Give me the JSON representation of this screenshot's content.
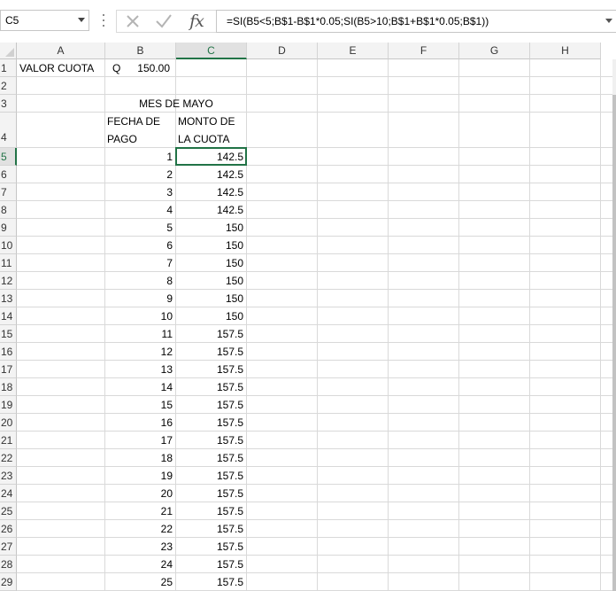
{
  "namebox": {
    "value": "C5"
  },
  "formula": {
    "text": "=SI(B5<5;B$1-B$1*0.05;SI(B5>10;B$1+B$1*0.05;B$1))",
    "fx_label": "fx"
  },
  "columns": [
    "A",
    "B",
    "C",
    "D",
    "E",
    "F",
    "G",
    "H"
  ],
  "rows": [
    "1",
    "2",
    "3",
    "4",
    "5",
    "6",
    "7",
    "8",
    "9",
    "10",
    "11",
    "12",
    "13",
    "14",
    "15",
    "16",
    "17",
    "18",
    "19",
    "20",
    "21",
    "22",
    "23",
    "24",
    "25",
    "26",
    "27",
    "28",
    "29"
  ],
  "cells": {
    "a1": "VALOR CUOTA",
    "b1_prefix": "Q",
    "b1_value": "150.00",
    "title": "MES DE MAYO",
    "header_b_line1": "FECHA DE",
    "header_b_line2": "PAGO",
    "header_c_line1": "MONTO DE",
    "header_c_line2": "LA CUOTA"
  },
  "table": [
    {
      "day": "1",
      "amount": "142.5"
    },
    {
      "day": "2",
      "amount": "142.5"
    },
    {
      "day": "3",
      "amount": "142.5"
    },
    {
      "day": "4",
      "amount": "142.5"
    },
    {
      "day": "5",
      "amount": "150"
    },
    {
      "day": "6",
      "amount": "150"
    },
    {
      "day": "7",
      "amount": "150"
    },
    {
      "day": "8",
      "amount": "150"
    },
    {
      "day": "9",
      "amount": "150"
    },
    {
      "day": "10",
      "amount": "150"
    },
    {
      "day": "11",
      "amount": "157.5"
    },
    {
      "day": "12",
      "amount": "157.5"
    },
    {
      "day": "13",
      "amount": "157.5"
    },
    {
      "day": "14",
      "amount": "157.5"
    },
    {
      "day": "15",
      "amount": "157.5"
    },
    {
      "day": "16",
      "amount": "157.5"
    },
    {
      "day": "17",
      "amount": "157.5"
    },
    {
      "day": "18",
      "amount": "157.5"
    },
    {
      "day": "19",
      "amount": "157.5"
    },
    {
      "day": "20",
      "amount": "157.5"
    },
    {
      "day": "21",
      "amount": "157.5"
    },
    {
      "day": "22",
      "amount": "157.5"
    },
    {
      "day": "23",
      "amount": "157.5"
    },
    {
      "day": "24",
      "amount": "157.5"
    },
    {
      "day": "25",
      "amount": "157.5"
    }
  ],
  "selection": {
    "column": "C",
    "row": "5"
  },
  "colors": {
    "accent": "#217346",
    "header_bg": "#f3f3f3",
    "grid_line": "#d9d9d9"
  }
}
